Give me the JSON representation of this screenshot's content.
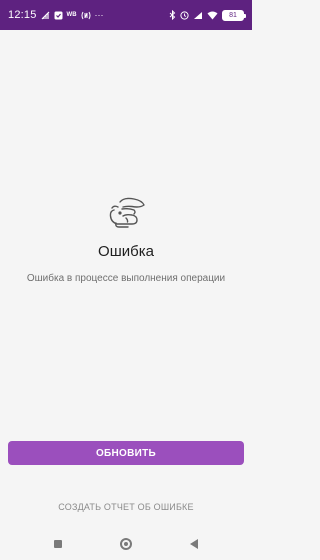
{
  "status_bar": {
    "time": "12:15",
    "left_icons": [
      "signal-off-icon",
      "notification-icon",
      "wb-icon",
      "nfc-icon",
      "more-dots-icon"
    ],
    "wb_label": "WB",
    "more_label": "···",
    "right_icons": [
      "bluetooth-icon",
      "alarm-icon",
      "signal-icon",
      "wifi-icon",
      "battery-icon"
    ],
    "battery_level": "81"
  },
  "error": {
    "illustration": "hare-illustration-icon",
    "title": "Ошибка",
    "description": "Ошибка в процессе выполнения операции"
  },
  "actions": {
    "refresh_label": "ОБНОВИТЬ",
    "report_label": "СОЗДАТЬ ОТЧЕТ ОБ ОШИБКЕ"
  },
  "navigation": {
    "buttons": [
      "recent-apps-icon",
      "home-icon",
      "back-icon"
    ]
  },
  "colors": {
    "status_bar": "#5e2280",
    "accent_button": "#9b4fbd",
    "background": "#f5f5f5"
  }
}
